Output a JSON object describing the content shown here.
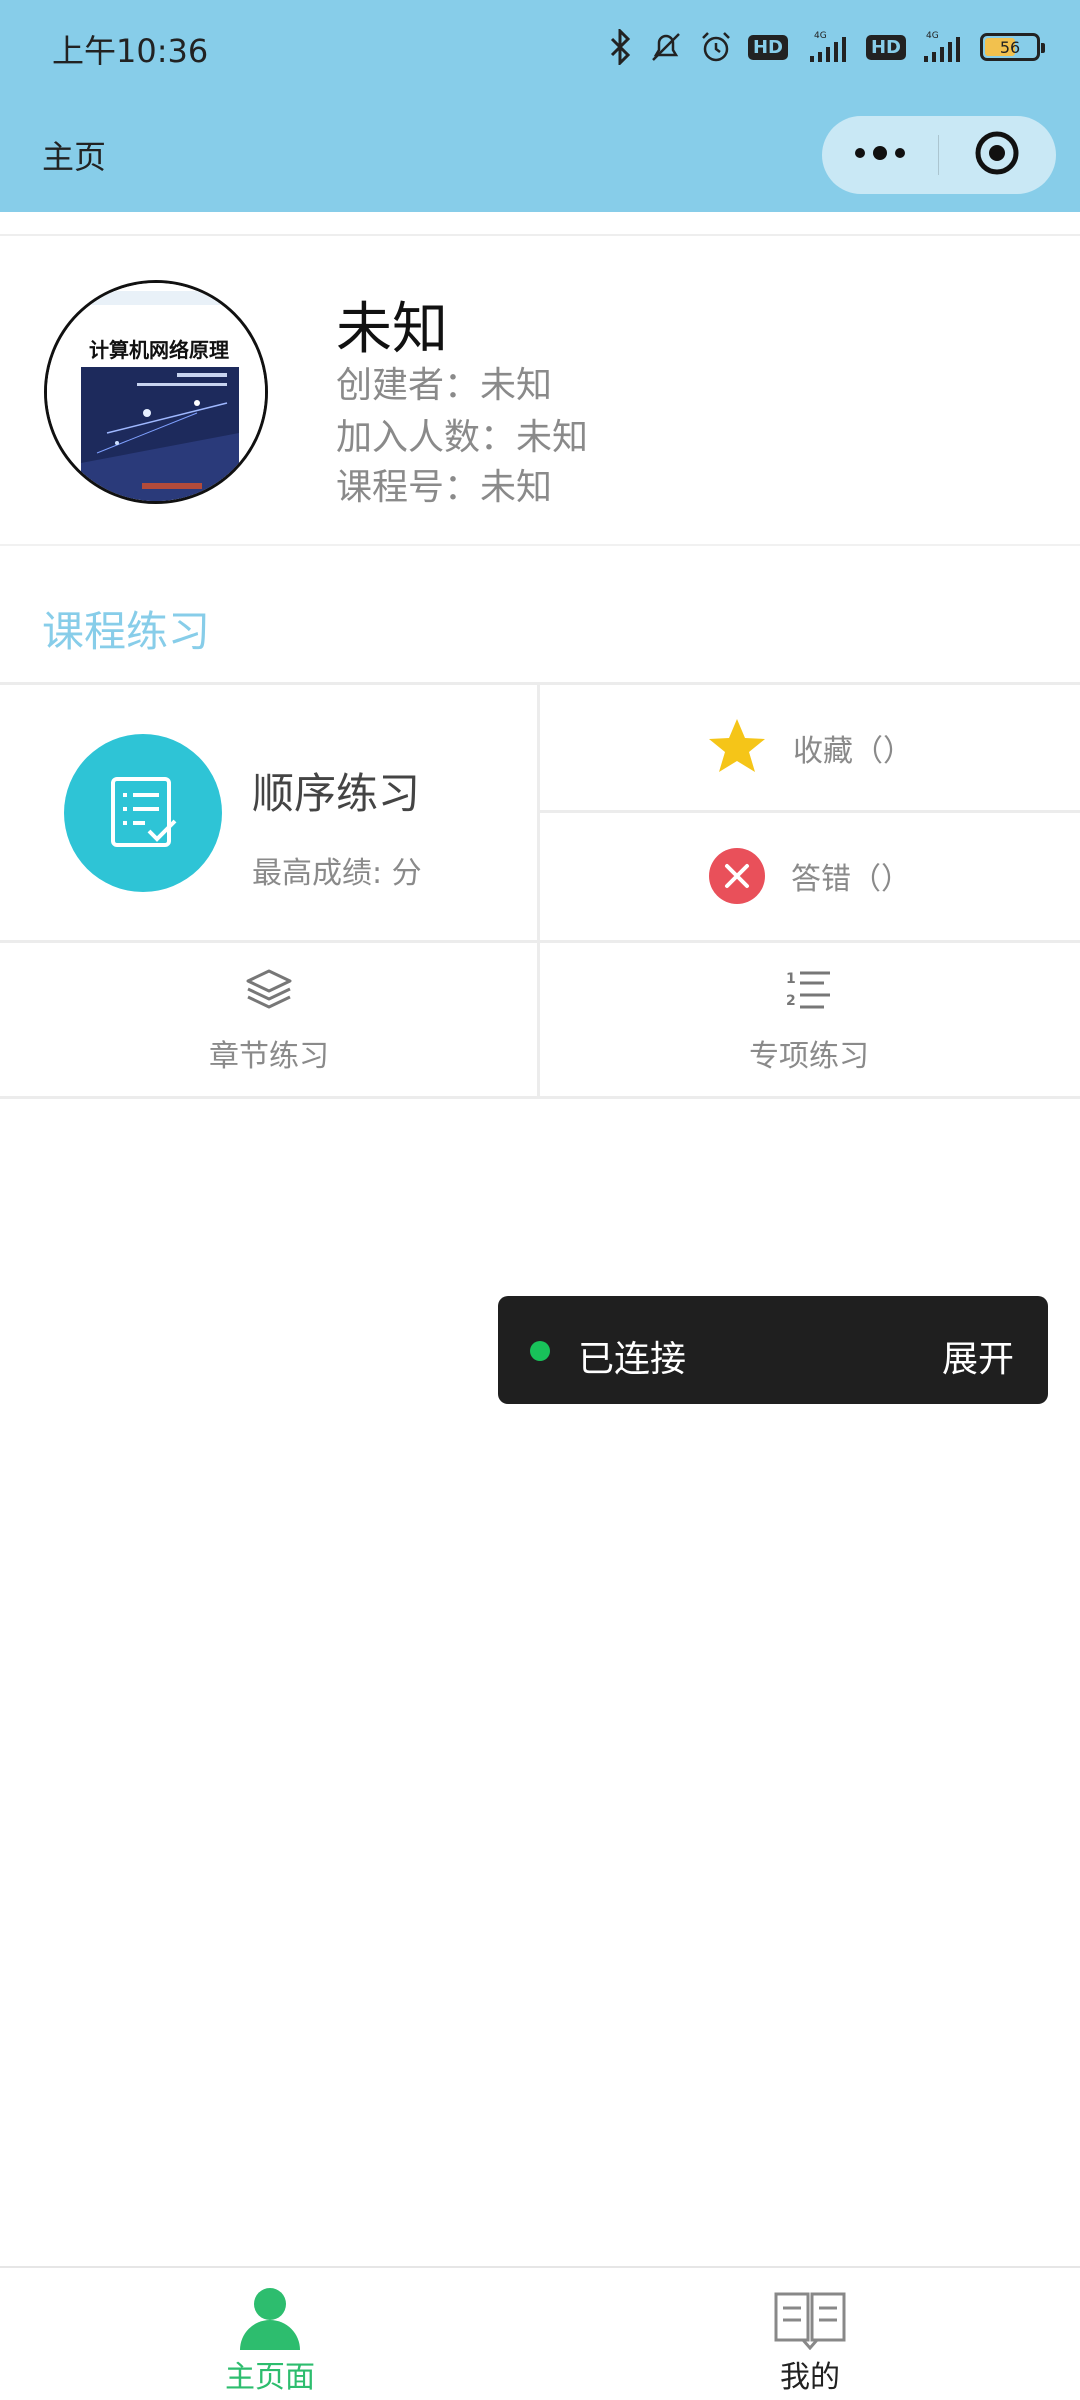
{
  "status_bar": {
    "time": "上午10:36",
    "battery": "56",
    "hd_label": "HD",
    "network": "4G"
  },
  "nav": {
    "title": "主页",
    "capsule_more_icon": "more-dots-icon",
    "capsule_close_icon": "target-close-icon"
  },
  "course": {
    "cover_title": "计算机网络原理",
    "name": "未知",
    "creator": "创建者：未知",
    "members": "加入人数：未知",
    "code": "课程号：未知"
  },
  "practice": {
    "section_title": "课程练习",
    "sequential": {
      "title": "顺序练习",
      "best_score": "最高成绩: 分"
    },
    "favorites_label": "收藏（）",
    "wrong_label": "答错（）",
    "chapter_label": "章节练习",
    "special_label": "专项练习"
  },
  "toast": {
    "status": "已连接",
    "expand": "展开"
  },
  "tabbar": {
    "home": "主页面",
    "mine": "我的"
  },
  "colors": {
    "nav_bg": "#87cde9",
    "accent_teal": "#2ec4d6",
    "star": "#f5c518",
    "wrong": "#e9505a",
    "active_tab": "#2dbd6e",
    "connected_dot": "#18c25a"
  }
}
